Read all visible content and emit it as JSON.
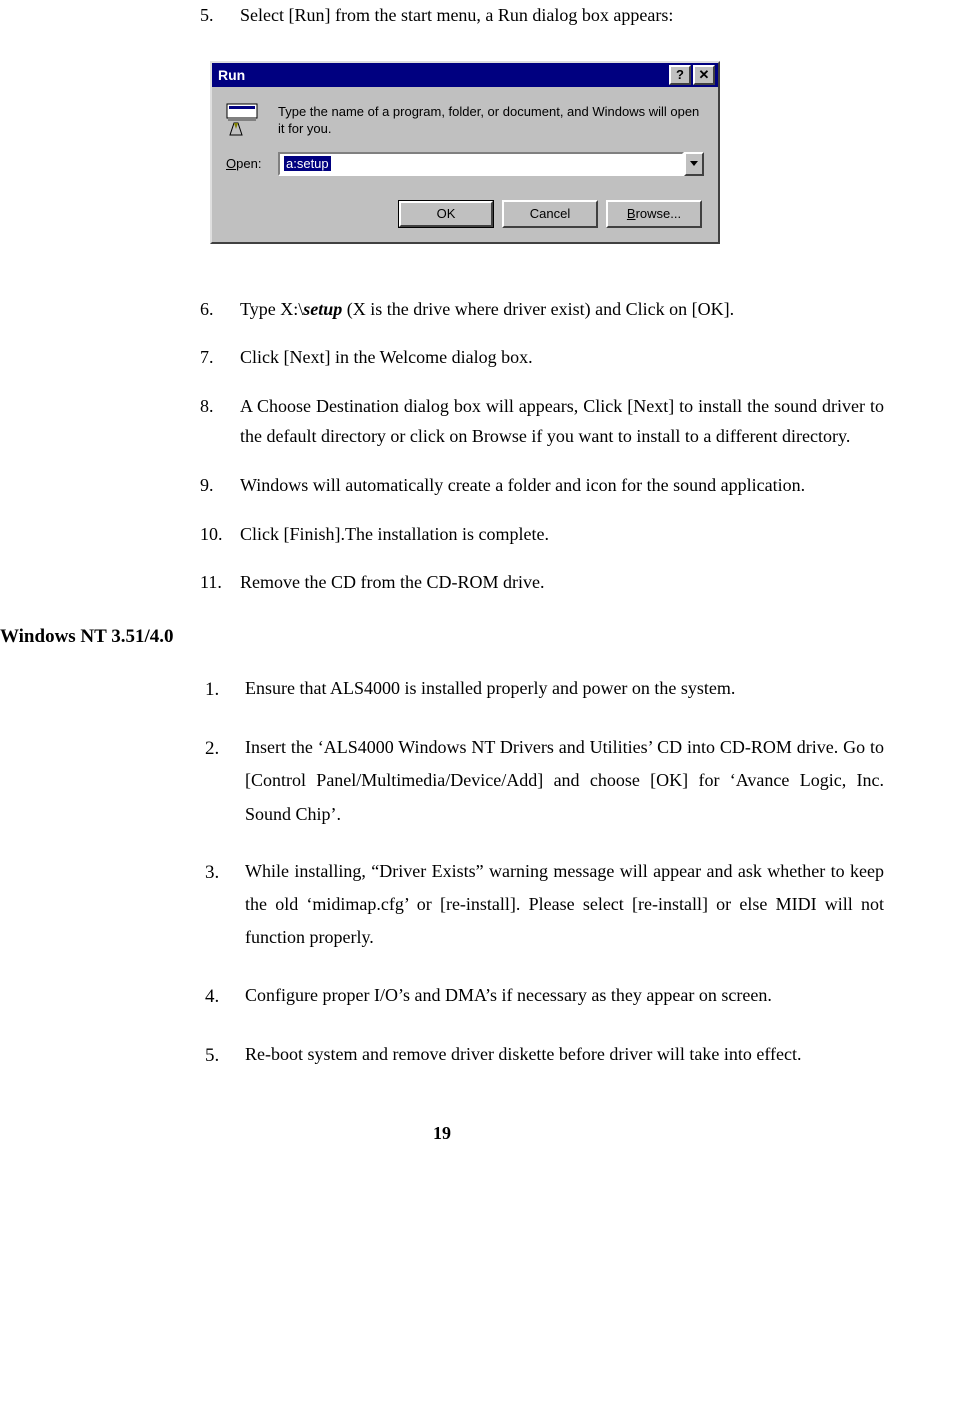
{
  "listA": [
    {
      "num": "5.",
      "text_pre": "Select [Run] from the start menu, a Run dialog box appears:"
    },
    {
      "num": "6.",
      "text_pre": " Type  X:\\",
      "setup": "setup",
      "text_post": " (X is the drive where driver exist) and Click on [OK]."
    },
    {
      "num": "7.",
      "text_pre": "Click [Next] in the Welcome dialog box."
    },
    {
      "num": "8.",
      "text_pre": "A Choose Destination dialog box will appears, Click [Next] to install the sound driver to the default directory or click on Browse if you want to install to a different directory."
    },
    {
      "num": "9.",
      "text_pre": "Windows will automatically create a folder and icon for the sound application."
    },
    {
      "num": "10.",
      "text_pre": "Click [Finish].The installation is complete."
    },
    {
      "num": "11.",
      "text_pre": " Remove the CD from the CD-ROM drive."
    }
  ],
  "heading": "Windows NT 3.51/4.0",
  "listB": [
    {
      "num": "1.",
      "text": "Ensure that ALS4000 is installed properly and power on the system."
    },
    {
      "num": "2.",
      "text": "Insert the ‘ALS4000 Windows NT Drivers and Utilities’ CD into CD-ROM drive.  Go to [Control Panel/Multimedia/Device/Add] and choose [OK] for ‘Avance Logic, Inc. Sound Chip’."
    },
    {
      "num": "3.",
      "text": "While installing, “Driver Exists” warning message will appear and ask whether to keep the old ‘midimap.cfg’ or [re-install].  Please select [re-install] or else MIDI will not function properly."
    },
    {
      "num": "4.",
      "text": "Configure proper I/O’s and DMA’s if necessary as they appear on screen."
    },
    {
      "num": "5.",
      "text": "Re-boot system and remove driver diskette before driver will take into effect."
    }
  ],
  "run_dialog": {
    "title": "Run",
    "help_btn": "?",
    "close_btn": "✕",
    "instruction": "Type the name of a program, folder, or document, and Windows will open it for you.",
    "open_label_u": "O",
    "open_label_rest": "pen:",
    "open_value": "a:setup",
    "ok": "OK",
    "cancel": "Cancel",
    "browse_u": "B",
    "browse_rest": "rowse..."
  },
  "page_number": "19"
}
